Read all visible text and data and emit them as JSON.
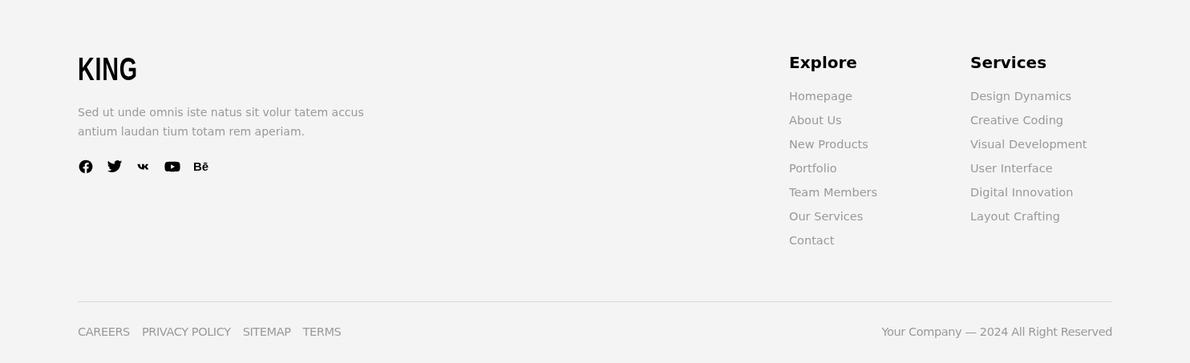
{
  "brand": {
    "logo": "KING",
    "description": "Sed ut unde omnis iste natus sit volur tatem accus antium laudan tium totam rem aperiam."
  },
  "social": [
    {
      "kind": "facebook"
    },
    {
      "kind": "twitter"
    },
    {
      "kind": "vk"
    },
    {
      "kind": "youtube"
    },
    {
      "kind": "behance",
      "glyph": "Bē"
    }
  ],
  "columns": [
    {
      "title": "Explore",
      "links": [
        "Homepage",
        "About Us",
        "New Products",
        "Portfolio",
        "Team Members",
        "Our Services",
        "Contact"
      ]
    },
    {
      "title": "Services",
      "links": [
        "Design Dynamics",
        "Creative Coding",
        "Visual Development",
        "User Interface",
        "Digital Innovation",
        "Layout Crafting"
      ]
    }
  ],
  "bottom_links": [
    "CAREERS",
    "PRIVACY POLICY",
    "SITEMAP",
    "TERMS"
  ],
  "copyright": "Your Company — 2024 All Right Reserved"
}
